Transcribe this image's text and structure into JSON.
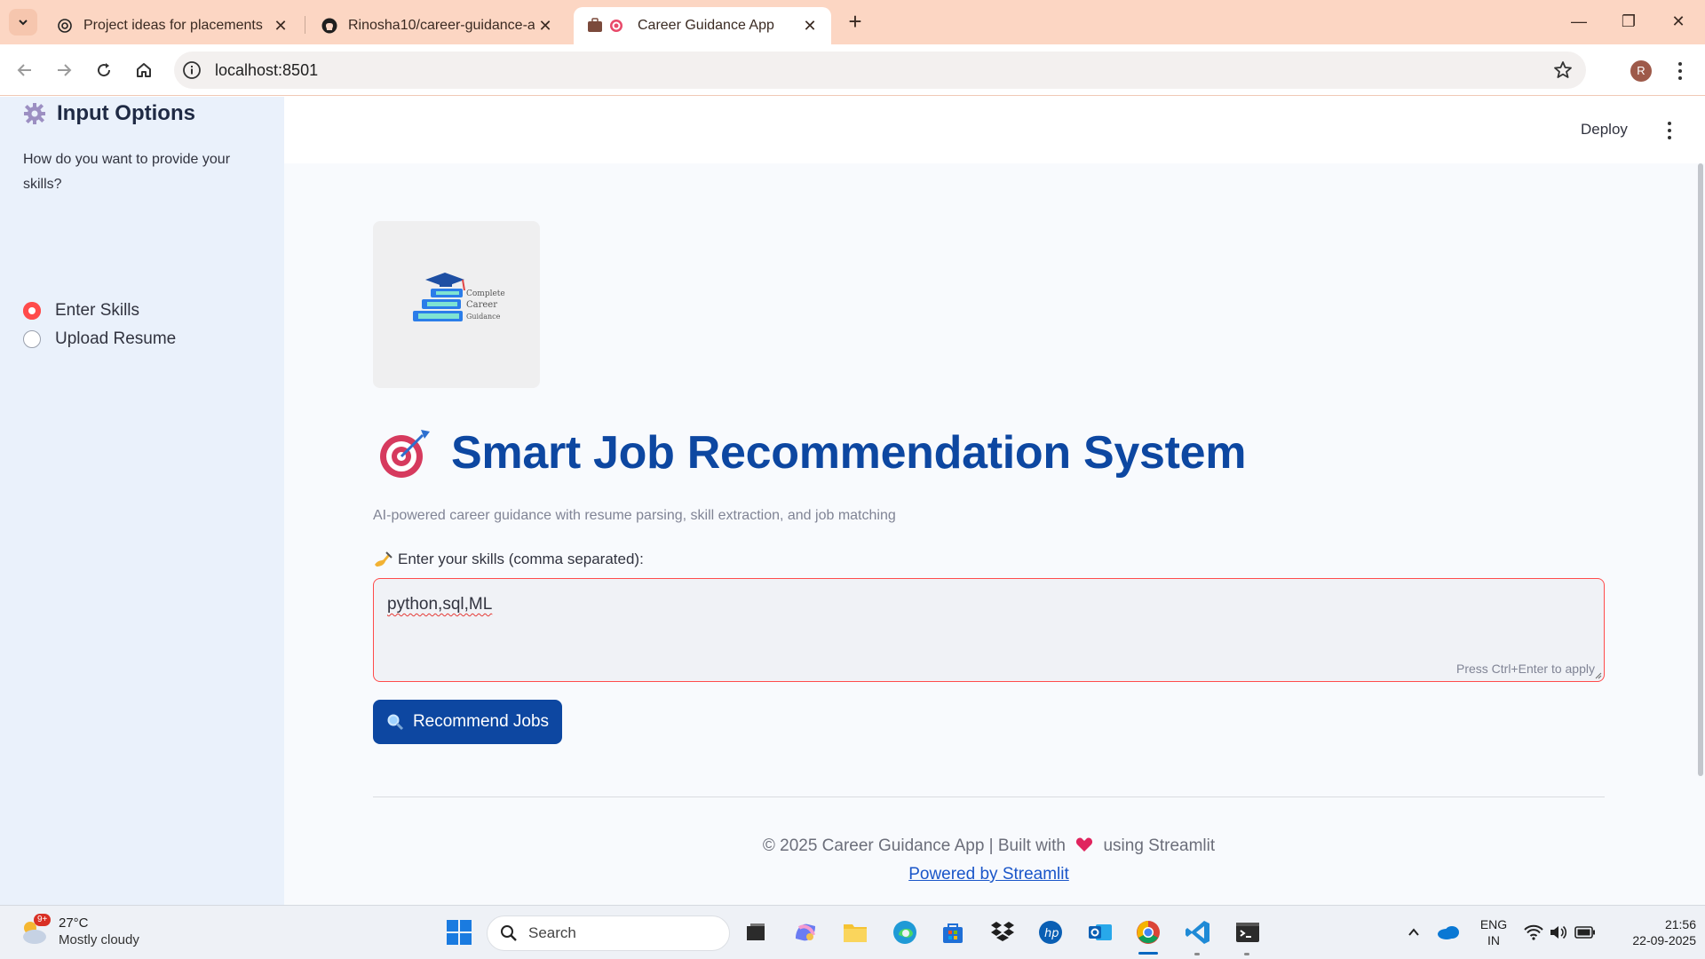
{
  "browser": {
    "tabs": [
      {
        "title": "Project ideas for placements",
        "icon": "chatgpt-icon"
      },
      {
        "title": "Rinosha10/career-guidance-app",
        "icon": "github-icon"
      },
      {
        "title": "Career Guidance App",
        "icon": "briefcase-target-icon",
        "active": true
      }
    ],
    "url": "localhost:8501"
  },
  "header": {
    "deploy_label": "Deploy"
  },
  "sidebar": {
    "title": "Input Options",
    "question": "How do you want to provide your skills?",
    "options": [
      {
        "label": "Enter Skills",
        "selected": true
      },
      {
        "label": "Upload Resume",
        "selected": false
      }
    ]
  },
  "main": {
    "logo_lines": [
      "Complete",
      "Career",
      "Guidance"
    ],
    "title": "Smart Job Recommendation System",
    "subtitle": "AI-powered career guidance with resume parsing, skill extraction, and job matching",
    "skills_label": "Enter your skills (comma separated):",
    "skills_value": "python,sql,ML",
    "skills_hint": "Press Ctrl+Enter to apply",
    "button_label": "Recommend Jobs",
    "footer_prefix": "© 2025 Career Guidance App | Built with",
    "footer_suffix": "using Streamlit",
    "footer_link": "Powered by Streamlit"
  },
  "taskbar": {
    "weather_badge": "9+",
    "temperature": "27°C",
    "weather_desc": "Mostly cloudy",
    "search_placeholder": "Search",
    "language_line1": "ENG",
    "language_line2": "IN",
    "time": "21:56",
    "date": "22-09-2025"
  },
  "colors": {
    "accent_blue": "#0d47a1",
    "streamlit_red": "#ff4b4b",
    "tab_strip": "#fcd6c3",
    "sidebar_bg": "#eaf1fb"
  }
}
